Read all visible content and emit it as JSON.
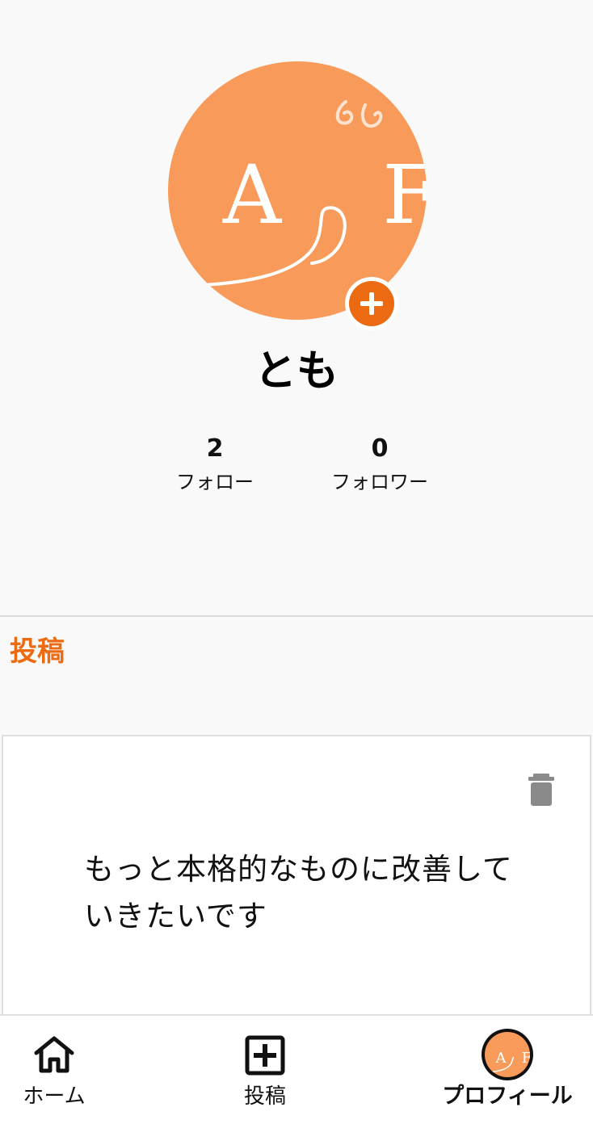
{
  "profile": {
    "username": "とも",
    "avatar_letters": [
      "A",
      "F"
    ],
    "avatar_color": "#f89b5a",
    "add_avatar_icon": "plus-icon"
  },
  "stats": {
    "follow_count": "2",
    "follow_label": "フォロー",
    "follower_count": "0",
    "follower_label": "フォロワー"
  },
  "posts_section": {
    "title": "投稿",
    "items": [
      {
        "text": "もっと本格的なものに改善していきたいです",
        "delete_icon": "trash-icon"
      }
    ]
  },
  "bottom_nav": {
    "items": [
      {
        "label": "ホーム",
        "icon": "home-icon",
        "active": false
      },
      {
        "label": "投稿",
        "icon": "add-box-icon",
        "active": false
      },
      {
        "label": "プロフィール",
        "icon": "profile-avatar-icon",
        "active": true
      }
    ]
  },
  "colors": {
    "accent": "#ec6a12",
    "background": "#f9f9f9",
    "card": "#ffffff",
    "icon_gray": "#8a8a8a"
  }
}
